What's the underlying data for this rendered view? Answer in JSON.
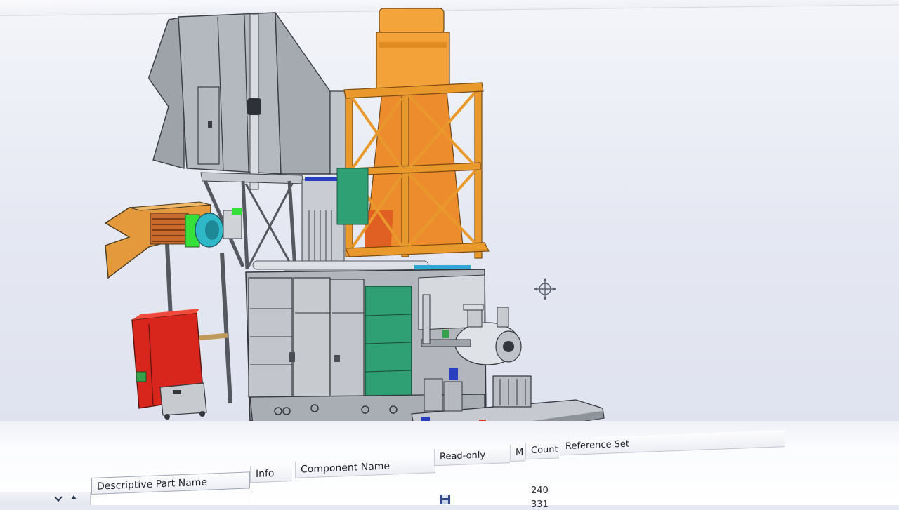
{
  "window": {
    "title": "",
    "background_color": "#e5e8f2"
  },
  "viewport": {
    "model": "Equipment skid assembly",
    "cursor_icon": "move-crosshair-icon",
    "colors": {
      "stack": "#f0a236",
      "frame": "#ea9a2c",
      "enclosure": "#b3b7bd",
      "green_door": "#2ea073",
      "red_cabinet": "#d8261c",
      "bright_green": "#36e03a",
      "cyan": "#2fb9c8"
    }
  },
  "parts_navigator": {
    "columns": [
      "Descriptive Part Name",
      "Info",
      "Component Name",
      "Read-only",
      "M",
      "Count",
      "Reference Set"
    ],
    "rows": [
      {
        "count": "240"
      },
      {
        "count": "331"
      }
    ],
    "icons": {
      "expand": "expand-check-icon",
      "collapse": "caret-up-icon",
      "save": "save-disk-icon"
    }
  }
}
